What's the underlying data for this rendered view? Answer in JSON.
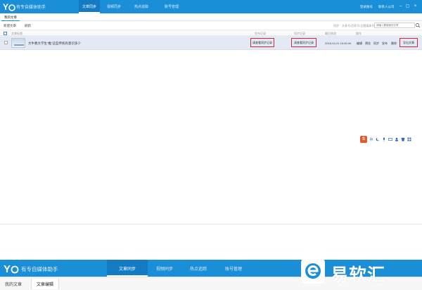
{
  "app": {
    "title": "有专自媒体助手",
    "nav": [
      "文章同步",
      "视频同步",
      "热点追踪",
      "账号管理"
    ],
    "top_links": [
      "登录账号",
      "联系人公司"
    ],
    "window_controls": [
      "minimize-icon",
      "maximize-icon",
      "close-icon"
    ]
  },
  "subtabs": [
    "我的文章"
  ],
  "toolbar": {
    "new_article": "新建文章",
    "refresh": "刷新",
    "hint": "同步：头条号/百家号/企鹅媒体号",
    "search_placeholder": "请输入要搜索的文章"
  },
  "table": {
    "columns": [
      "文章标题",
      "发布记录",
      "同步记录",
      "最后修改",
      "操作"
    ],
    "rows": [
      {
        "title": "大牛教大学生“推”这些传统有意识多少",
        "publish_status": "请查看同步记录",
        "sync_status": "请查看同步记录",
        "modified": "2018-04-21 19:06:09",
        "actions": [
          "编辑",
          "预览",
          "同步",
          "发布",
          "删除",
          "导出文章"
        ]
      }
    ]
  },
  "float_toolbar": {
    "brand": "S",
    "icons": [
      "language-icon",
      "moon-icon",
      "microphone-icon",
      "keyboard-icon",
      "user-icon",
      "shirt-icon",
      "grid-icon"
    ]
  },
  "bottom": {
    "title": "有专自媒体助手",
    "nav": [
      "文章同步",
      "视频同步",
      "热点追踪",
      "账号管理"
    ],
    "tabs": [
      "我的文章",
      "文章编辑"
    ]
  },
  "watermark": {
    "text": "易软汇"
  },
  "colors": {
    "brand": "#1a8fd8",
    "highlight": "#d0283a",
    "selected_row": "#e3eaf6"
  }
}
